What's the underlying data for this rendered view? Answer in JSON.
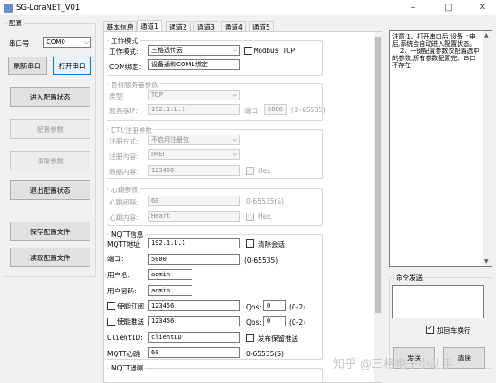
{
  "window": {
    "title": "SG-LoraNET_V01",
    "minimize": "–",
    "maximize": "□",
    "close": "✕"
  },
  "config": {
    "group_title": "配置",
    "port_label": "串口号:",
    "port_value": "COM0",
    "refresh_btn": "刷新串口",
    "open_btn": "打开串口",
    "enter_cfg": "进入配置状态",
    "cfg_params": "配置参数",
    "read_params": "读取参数",
    "exit_cfg": "退出配置状态",
    "save_file": "保存配置文件",
    "read_file": "读取配置文件"
  },
  "tabs": [
    "基本信息",
    "通道1",
    "通道2",
    "通道3",
    "通道4",
    "通道5"
  ],
  "work": {
    "title": "工作模式",
    "mode_label": "工作模式:",
    "mode_value": "三格透传云",
    "modbus_label": "Modbus TCP",
    "com_label": "COM绑定:",
    "com_value": "设备通和COM1绑定"
  },
  "server": {
    "title": "目标服务器参数",
    "type_label": "类型:",
    "type_value": "TCP",
    "ip_label": "服务器IP:",
    "ip_value": "192.1.1.1",
    "port_label": "端口",
    "port_value": "5000",
    "port_range": "(0-65535)"
  },
  "dtu": {
    "title": "DTU注册参数",
    "method_label": "注册方式:",
    "method_value": "不启用注册包",
    "content_label": "注册内容:",
    "content_value": "IMEI",
    "data_label": "数据内容:",
    "data_value": "123456",
    "hex_label": "Hex"
  },
  "heart": {
    "title": "心跳参数",
    "interval_label": "心跳间隔:",
    "interval_value": "60",
    "interval_range": "0-65535(S)",
    "content_label": "心跳内容:",
    "content_value": "Heart",
    "hex_label": "Hex"
  },
  "mqtt": {
    "title": "MQTT信息",
    "addr_label": "MQTT地址",
    "addr_value": "192.1.1.1",
    "clear_label": "清除会话",
    "port_label": "端口:",
    "port_value": "5000",
    "port_range": "(0-65535)",
    "user_label": "用户名:",
    "user_value": "admin",
    "pwd_label": "用户密码:",
    "pwd_value": "admin",
    "sub_label": "使能订阅",
    "sub_value": "123456",
    "qos_label": "Qos:",
    "qos_sub": "0",
    "qos_range": "(0-2)",
    "pub_label": "使能推送",
    "pub_value": "123456",
    "qos_pub": "0",
    "clientid_label": "ClientID:",
    "clientid_value": "clientID",
    "retain_label": "发布保留推送",
    "keepalive_label": "MQTT心跳:",
    "keepalive_value": "60",
    "keepalive_range": "0-65535(S)",
    "bottom_title": "MQTT遗嘱"
  },
  "notes": {
    "text": "注意:1、打开串口后,设备上电后,系统会自动进入配置状态。\n    2、一键配置参数仅配置选中的参数,所有参数配置完。串口不存在"
  },
  "cmd": {
    "title": "命令发送",
    "crlf_label": "加回车换行",
    "send_btn": "发送",
    "clear_btn": "清除"
  },
  "watermark": "知乎 @三格电子小助手"
}
